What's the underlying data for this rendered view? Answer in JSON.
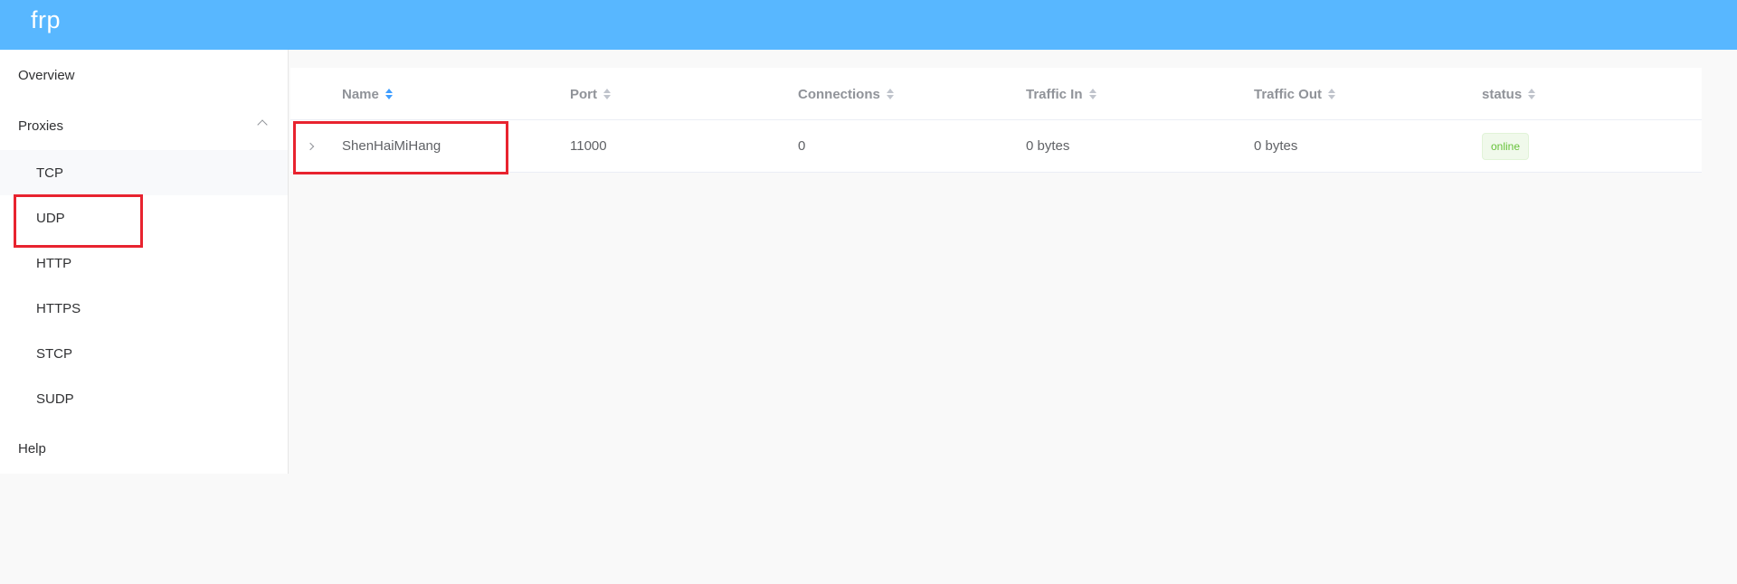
{
  "header": {
    "brand": "frp",
    "color": "#58b7ff"
  },
  "sidebar": {
    "overview": "Overview",
    "proxies": "Proxies",
    "proxy_types": [
      "TCP",
      "UDP",
      "HTTP",
      "HTTPS",
      "STCP",
      "SUDP"
    ],
    "help": "Help"
  },
  "table": {
    "columns": [
      "Name",
      "Port",
      "Connections",
      "Traffic In",
      "Traffic Out",
      "status"
    ],
    "sorted_column": "Name",
    "rows": [
      {
        "name": "ShenHaiMiHang",
        "port": "11000",
        "connections": "0",
        "traffic_in": "0 bytes",
        "traffic_out": "0 bytes",
        "status": "online"
      }
    ]
  },
  "colors": {
    "highlight": "#e8232f",
    "online": "#67c23a",
    "sort_active": "#409eff"
  }
}
